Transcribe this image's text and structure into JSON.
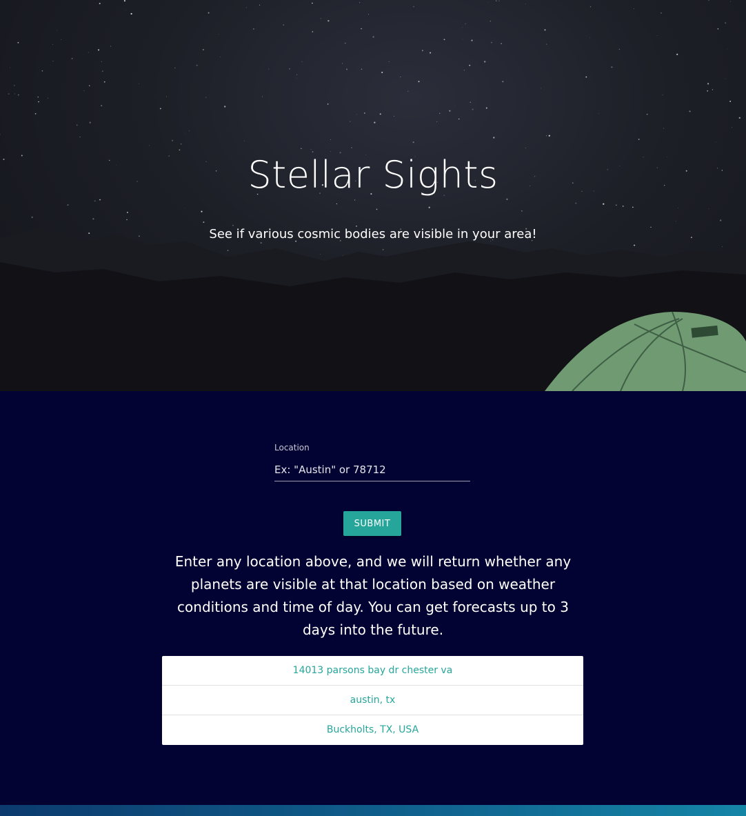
{
  "hero": {
    "title": "Stellar Sights",
    "subtitle": "See if various cosmic bodies are visible in your area!"
  },
  "form": {
    "location_label": "Location",
    "location_placeholder": "Ex: \"Austin\" or 78712",
    "location_value": "",
    "submit_label": "SUBMIT"
  },
  "description": "Enter any location above, and we will return whether any planets are visible at that location based on weather conditions and time of day. You can get forecasts up to 3 days into the future.",
  "history": {
    "items": [
      "14013 parsons bay dr chester va",
      "austin, tx",
      "Buckholts, TX, USA"
    ]
  },
  "colors": {
    "page_background": "#020233",
    "accent": "#26a69a",
    "tent": "#6f9a72"
  }
}
